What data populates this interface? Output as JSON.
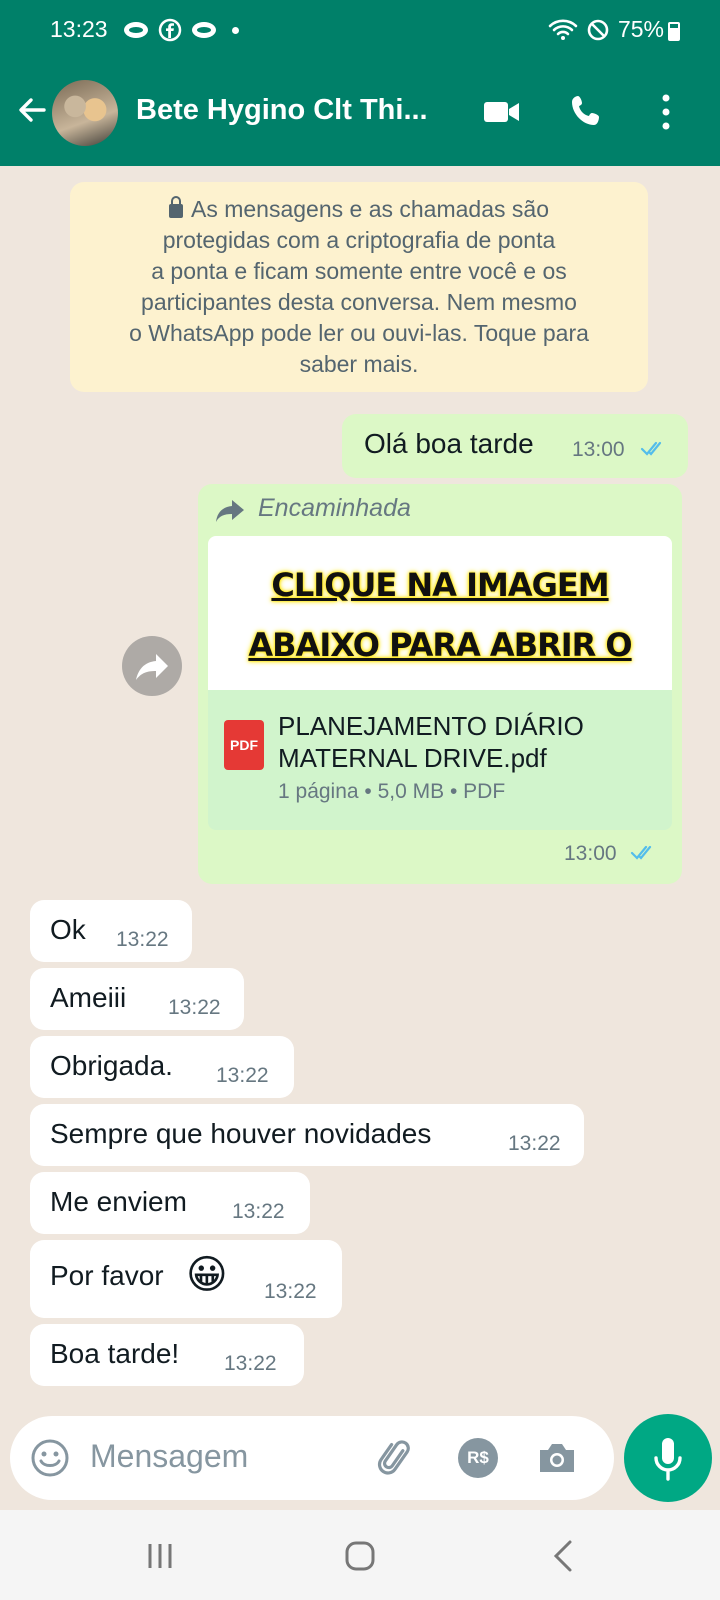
{
  "status_bar": {
    "time": "13:23",
    "battery": "75%"
  },
  "header": {
    "contact_name": "Bete Hygino Clt Thi..."
  },
  "encryption_notice": {
    "lines": [
      "As mensagens e as chamadas são",
      "protegidas com a criptografia de ponta",
      "a ponta e ficam somente entre você e os",
      "participantes desta conversa. Nem mesmo",
      "o WhatsApp pode ler ou ouvi-las. Toque para",
      "saber mais."
    ]
  },
  "messages_out": [
    {
      "text": "Olá boa tarde",
      "time": "13:00"
    }
  ],
  "forwarded": {
    "label": "Encaminhada",
    "preview_lines": [
      "CLIQUE NA IMAGEM",
      "ABAIXO PARA ABRIR O"
    ],
    "file_icon": "PDF",
    "file_name_lines": [
      "PLANEJAMENTO DIÁRIO",
      "MATERNAL DRIVE.pdf"
    ],
    "file_meta": "1 página • 5,0 MB • PDF",
    "time": "13:00"
  },
  "messages_in": [
    {
      "text": "Ok",
      "time": "13:22"
    },
    {
      "text": "Ameiii",
      "time": "13:22"
    },
    {
      "text": "Obrigada.",
      "time": "13:22"
    },
    {
      "text": "Sempre que houver novidades",
      "time": "13:22"
    },
    {
      "text": "Me enviem",
      "time": "13:22"
    },
    {
      "text": "Por favor",
      "emoji": "😀",
      "time": "13:22"
    },
    {
      "text": "Boa tarde!",
      "time": "13:22"
    }
  ],
  "input": {
    "placeholder": "Mensagem",
    "payment_icon_text": "R$"
  },
  "colors": {
    "header": "#008069",
    "outgoing": "#dcf8c6",
    "incoming": "#ffffff",
    "accent": "#00a884",
    "tick_read": "#53bdeb"
  },
  "icons": [
    "back-arrow-icon",
    "video-call-icon",
    "phone-icon",
    "more-vert-icon",
    "lock-icon",
    "forward-icon",
    "pdf-icon",
    "emoji-icon",
    "attach-icon",
    "payment-icon",
    "camera-icon",
    "mic-icon"
  ]
}
